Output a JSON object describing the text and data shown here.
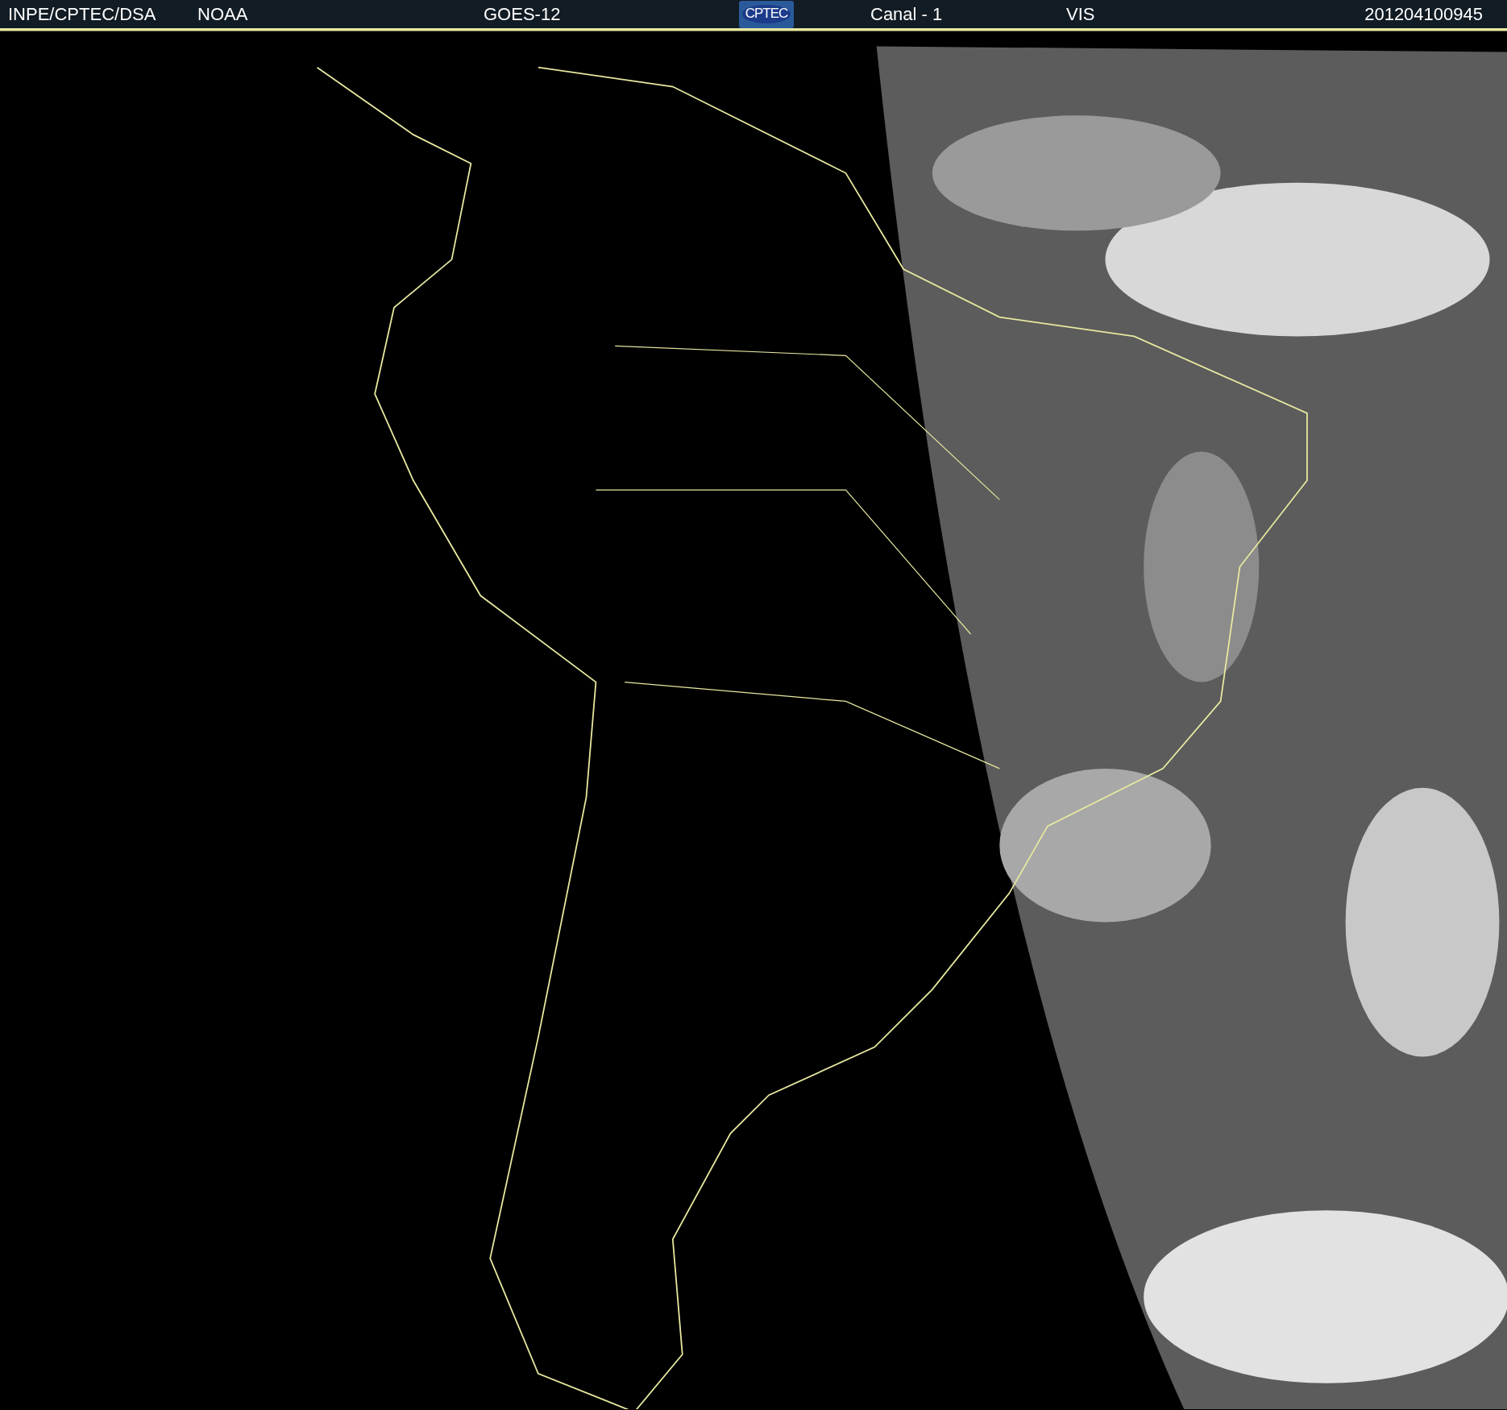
{
  "header": {
    "source": "INPE/CPTEC/DSA",
    "agency": "NOAA",
    "satellite": "GOES-12",
    "logo_text": "CPTEC",
    "channel": "Canal - 1",
    "band": "VIS",
    "timestamp": "201204100945"
  },
  "image": {
    "kind": "map-picture"
  }
}
